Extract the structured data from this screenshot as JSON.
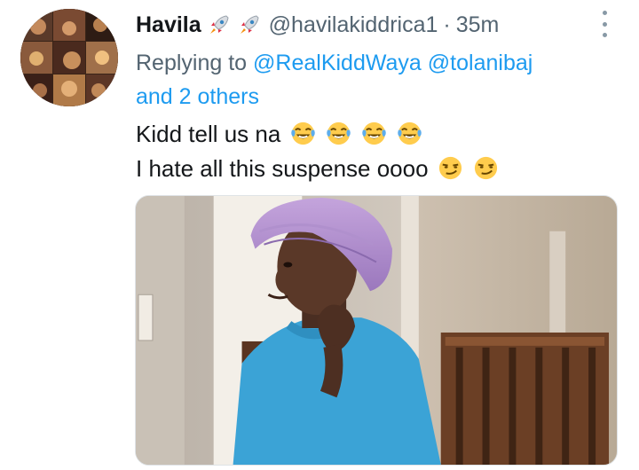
{
  "tweet": {
    "display_name": "Havila",
    "name_emojis": [
      "rocket-icon",
      "rocket-icon"
    ],
    "handle": "@havilakiddrica1",
    "separator": "·",
    "time": "35m",
    "reply": {
      "prefix": "Replying to",
      "mentions": [
        "@RealKiddWaya",
        "@tolanibaj"
      ],
      "others": "and 2 others"
    },
    "lines": [
      {
        "text": "Kidd tell us na",
        "emoji": "face-with-tears-of-joy",
        "emoji_count": 4
      },
      {
        "text": "I hate all this suspense oooo",
        "emoji": "smirking-face",
        "emoji_count": 2
      }
    ],
    "media": {
      "type": "image",
      "subject": "person-in-purple-bonnet"
    }
  },
  "colors": {
    "link": "#1d9bf0",
    "secondary": "#536471",
    "primary": "#14171a"
  }
}
